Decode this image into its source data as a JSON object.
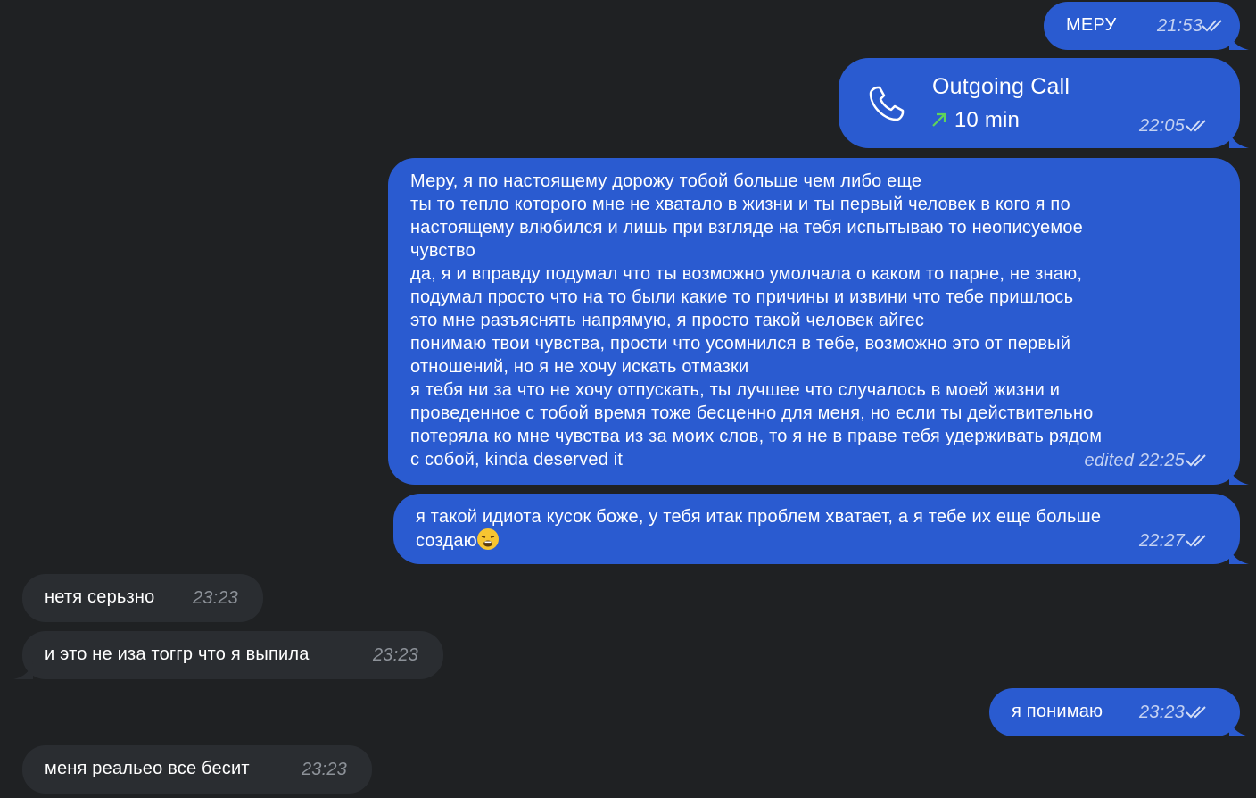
{
  "messages": [
    {
      "text": "МЕРУ",
      "time": "21:53"
    },
    {
      "call_title": "Outgoing Call",
      "call_duration": "10 min",
      "time": "22:05"
    },
    {
      "text": "Меру, я по настоящему дорожу тобой больше чем либо еще\nты то тепло которого мне не хватало в жизни и ты первый человек в кого я по\nнастоящему влюбился и лишь при взгляде на тебя испытываю то неописуемое\nчувство\nда, я и вправду подумал что ты возможно умолчала о каком то парне, не знаю,\nподумал просто что на то были какие то причины и извини что тебе пришлось\nэто мне разъяснять напрямую, я просто такой человек айгес\nпонимаю твои чувства, прости что усомнился в тебе, возможно это от первый\nотношений, но я не хочу искать отмазки\nя тебя ни за что не хочу отпускать, ты лучшее что случалось в моей жизни и\nпроведенное с тобой время тоже бесценно для меня, но если ты действительно\nпотеряла ко мне чувства из за моих слов, то я не в праве тебя удерживать рядом\nс собой, kinda deserved it",
      "time": "edited 22:25"
    },
    {
      "text": "я такой идиота кусок боже, у тебя итак проблем хватает, а я тебе их еще больше\nсоздаю",
      "emoji": "weary-face-emoji",
      "time": "22:27"
    },
    {
      "text": "нетя серьзно",
      "time": "23:23"
    },
    {
      "text": "и это не иза тоггр что я выпила",
      "time": "23:23"
    },
    {
      "text": "я понимаю",
      "time": "23:23"
    },
    {
      "text": "меня реальео все бесит",
      "time": "23:23"
    }
  ],
  "colors": {
    "background": "#1f2123",
    "outgoing_bubble": "#2a5bd0",
    "incoming_bubble": "#2a2d31",
    "call_arrow": "#5fd35a"
  },
  "icons": {
    "phone": "phone-icon",
    "read_receipt": "double-check-icon",
    "call_direction": "arrow-up-right-icon"
  }
}
